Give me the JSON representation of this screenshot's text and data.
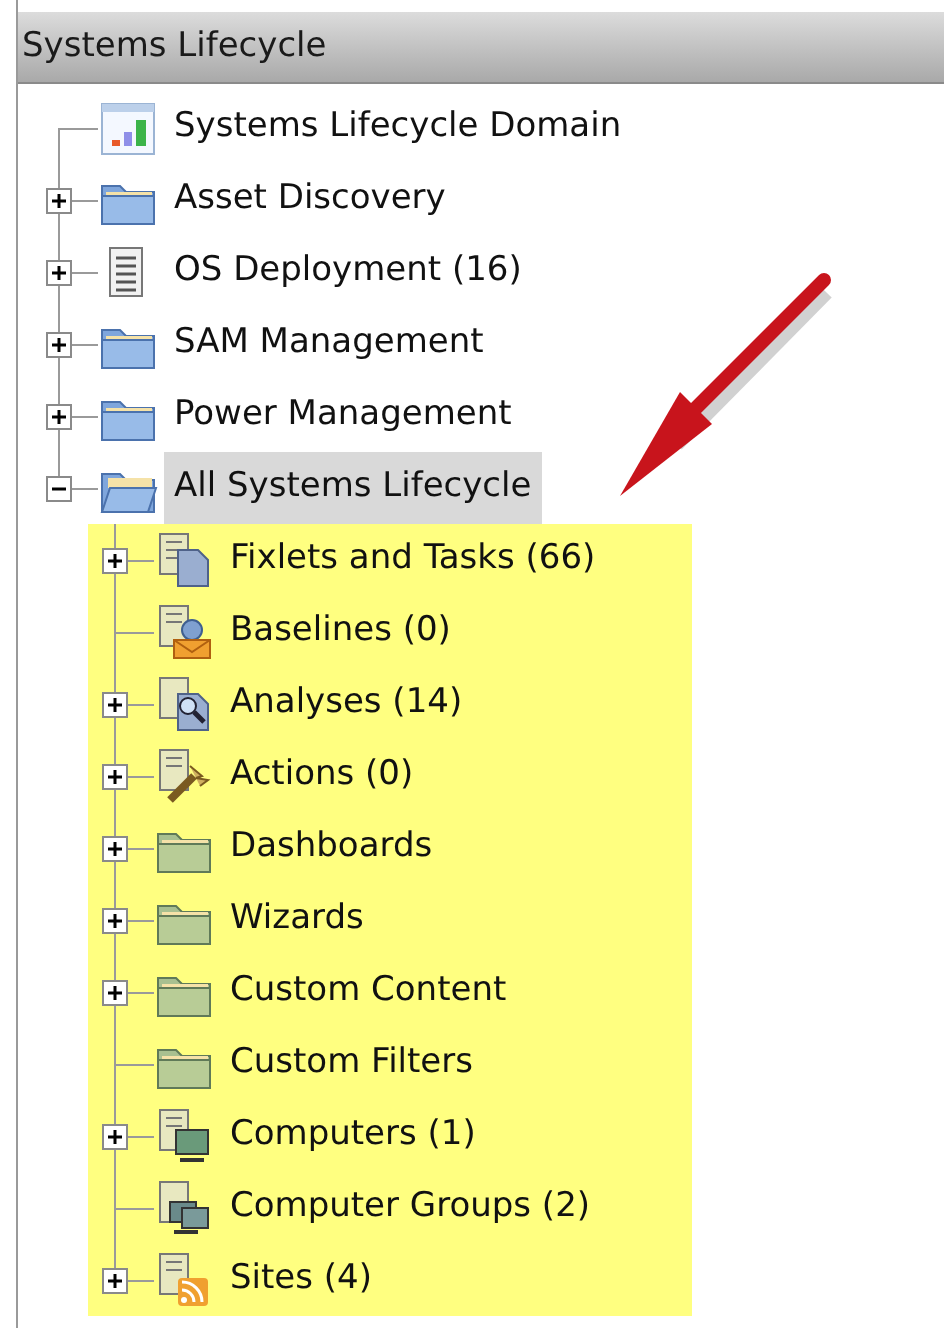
{
  "panel": {
    "title": "Systems Lifecycle"
  },
  "tree": [
    {
      "label": "Systems Lifecycle Domain",
      "kind": "chart",
      "selected": false
    },
    {
      "label": "Asset Discovery",
      "kind": "folder-blue",
      "expanded": false,
      "selected": false
    },
    {
      "label": "OS Deployment (16)",
      "kind": "list",
      "expanded": false,
      "selected": false
    },
    {
      "label": "SAM Management",
      "kind": "folder-blue",
      "expanded": false,
      "selected": false
    },
    {
      "label": "Power Management",
      "kind": "folder-blue",
      "expanded": false,
      "selected": false
    },
    {
      "label": "All Systems Lifecycle",
      "kind": "folder-open",
      "expanded": true,
      "selected": true,
      "children_highlighted": true,
      "children": [
        {
          "label": "Fixlets and Tasks (66)",
          "kind": "fixlet",
          "expanded": false,
          "selected": false
        },
        {
          "label": "Baselines (0)",
          "kind": "baseline",
          "selected": false
        },
        {
          "label": "Analyses (14)",
          "kind": "analysis",
          "expanded": false,
          "selected": false
        },
        {
          "label": "Actions (0)",
          "kind": "action",
          "expanded": false,
          "selected": false
        },
        {
          "label": "Dashboards",
          "kind": "folder-green",
          "expanded": false,
          "selected": false
        },
        {
          "label": "Wizards",
          "kind": "folder-green",
          "expanded": false,
          "selected": false
        },
        {
          "label": "Custom Content",
          "kind": "folder-green",
          "expanded": false,
          "selected": false
        },
        {
          "label": "Custom Filters",
          "kind": "folder-green",
          "selected": false
        },
        {
          "label": "Computers (1)",
          "kind": "computer",
          "expanded": false,
          "selected": false
        },
        {
          "label": "Computer Groups (2)",
          "kind": "computer-group",
          "selected": false
        },
        {
          "label": "Sites (4)",
          "kind": "site",
          "expanded": false,
          "selected": false
        }
      ]
    }
  ],
  "annotation": {
    "kind": "arrow"
  }
}
